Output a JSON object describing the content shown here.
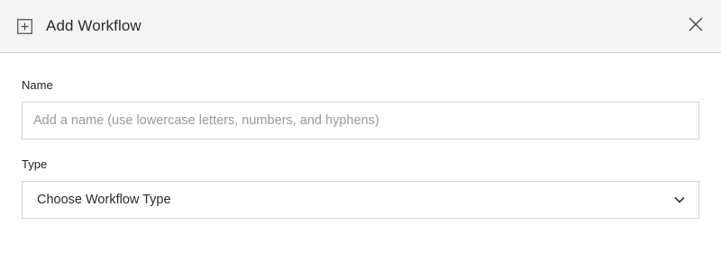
{
  "dialog": {
    "title": "Add Workflow",
    "header_icon": "add-square-icon",
    "close_icon": "close-icon"
  },
  "form": {
    "name": {
      "label": "Name",
      "placeholder": "Add a name (use lowercase letters, numbers, and hyphens)",
      "value": ""
    },
    "type": {
      "label": "Type",
      "selected": "Choose Workflow Type",
      "icon": "chevron-down-icon"
    }
  }
}
